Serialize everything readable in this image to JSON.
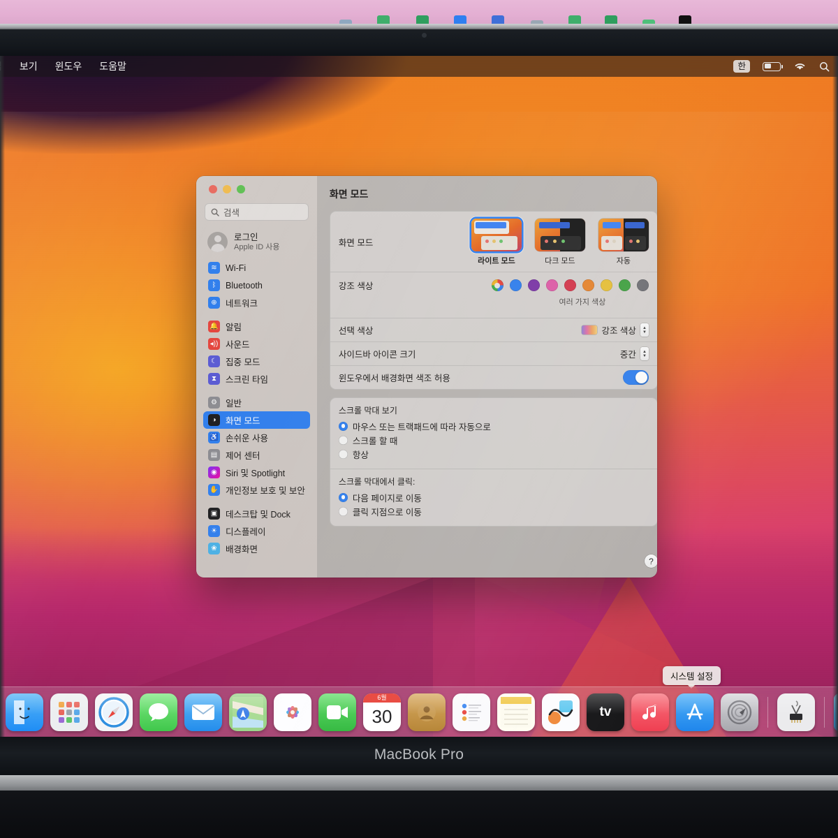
{
  "device": {
    "brand": "MacBook Pro"
  },
  "menubar": {
    "items": [
      "집",
      "보기",
      "윈도우",
      "도움말"
    ],
    "status": {
      "ime": "한",
      "battery_icon": "battery-icon",
      "wifi_icon": "wifi-icon",
      "search_icon": "search-icon"
    }
  },
  "window": {
    "title": "화면 모드",
    "traffic_lights": [
      "close",
      "minimize",
      "zoom"
    ],
    "search": {
      "placeholder": "검색",
      "icon": "search-icon"
    },
    "account": {
      "name": "로그인",
      "subtitle": "Apple ID 사용",
      "avatar": "avatar-placeholder"
    },
    "sidebar_groups": [
      [
        {
          "label": "Wi-Fi",
          "icon": "wifi-icon",
          "color": "#2f7ff0"
        },
        {
          "label": "Bluetooth",
          "icon": "bluetooth-icon",
          "color": "#2f7ff0"
        },
        {
          "label": "네트워크",
          "icon": "globe-icon",
          "color": "#2f7ff0"
        }
      ],
      [
        {
          "label": "알림",
          "icon": "bell-icon",
          "color": "#e8453c"
        },
        {
          "label": "사운드",
          "icon": "speaker-icon",
          "color": "#e8453c"
        },
        {
          "label": "집중 모드",
          "icon": "moon-icon",
          "color": "#5b5bd6"
        },
        {
          "label": "스크린 타임",
          "icon": "hourglass-icon",
          "color": "#5b5bd6"
        }
      ],
      [
        {
          "label": "일반",
          "icon": "gear-icon",
          "color": "#8e8e93"
        },
        {
          "label": "화면 모드",
          "icon": "appearance-icon",
          "color": "#1c1c1e",
          "selected": true
        },
        {
          "label": "손쉬운 사용",
          "icon": "accessibility-icon",
          "color": "#2f7ff0"
        },
        {
          "label": "제어 센터",
          "icon": "control-center-icon",
          "color": "#8e8e93"
        },
        {
          "label": "Siri 및 Spotlight",
          "icon": "siri-icon",
          "color": "#1c1c3e"
        },
        {
          "label": "개인정보 보호 및 보안",
          "icon": "hand-icon",
          "color": "#2f7ff0"
        }
      ],
      [
        {
          "label": "데스크탑 및 Dock",
          "icon": "desktop-dock-icon",
          "color": "#1c1c1e"
        },
        {
          "label": "디스플레이",
          "icon": "brightness-icon",
          "color": "#2f7ff0"
        },
        {
          "label": "배경화면",
          "icon": "wallpaper-icon",
          "color": "#4ab3e8"
        }
      ]
    ],
    "appearance": {
      "row_label": "화면 모드",
      "modes": [
        {
          "label": "라이트 모드",
          "selected": true
        },
        {
          "label": "다크 모드",
          "selected": false
        },
        {
          "label": "자동",
          "selected": false
        }
      ]
    },
    "accent": {
      "row_label": "강조 색상",
      "note": "여러 가지 색상",
      "swatches": [
        {
          "name": "multicolor",
          "color": "multi",
          "selected": true
        },
        {
          "name": "blue",
          "color": "#2f7ff0"
        },
        {
          "name": "purple",
          "color": "#7b34a8"
        },
        {
          "name": "pink",
          "color": "#e05aa8"
        },
        {
          "name": "red",
          "color": "#d6354a"
        },
        {
          "name": "orange",
          "color": "#e8842c"
        },
        {
          "name": "yellow",
          "color": "#e8c136"
        },
        {
          "name": "green",
          "color": "#3fa23f"
        },
        {
          "name": "graphite",
          "color": "#6e6e73"
        }
      ]
    },
    "rows": [
      {
        "label": "선택 색상",
        "value": "강조 색상",
        "control": "popup-with-gradient-chip"
      },
      {
        "label": "사이드바 아이콘 크기",
        "value": "중간",
        "control": "popup"
      },
      {
        "label": "윈도우에서 배경화면 색조 허용",
        "value": "on",
        "control": "toggle"
      }
    ],
    "scrollbar_show": {
      "title": "스크롤 막대 보기",
      "options": [
        {
          "label": "마우스 또는 트랙패드에 따라 자동으로",
          "selected": true
        },
        {
          "label": "스크롤 할 때",
          "selected": false
        },
        {
          "label": "항상",
          "selected": false
        }
      ]
    },
    "scrollbar_click": {
      "title": "스크롤 막대에서 클릭:",
      "options": [
        {
          "label": "다음 페이지로 이동",
          "selected": true
        },
        {
          "label": "클릭 지점으로 이동",
          "selected": false
        }
      ]
    },
    "help_button": "?"
  },
  "dock": {
    "tooltip": "시스템 설정",
    "calendar": {
      "month": "6월",
      "day": "30"
    },
    "items": [
      {
        "name": "finder",
        "label": "Finder",
        "color": "#1f8df5",
        "glyph": ""
      },
      {
        "name": "launchpad",
        "label": "Launchpad",
        "color": "#e9e9ec",
        "glyph": ""
      },
      {
        "name": "safari",
        "label": "Safari",
        "color": "#f2f2f4",
        "glyph": ""
      },
      {
        "name": "messages",
        "label": "메시지",
        "color": "#4fd45a",
        "glyph": ""
      },
      {
        "name": "mail",
        "label": "Mail",
        "color": "#2f9bf0",
        "glyph": ""
      },
      {
        "name": "maps",
        "label": "지도",
        "color": "#8fd17a",
        "glyph": ""
      },
      {
        "name": "photos",
        "label": "사진",
        "color": "#fbfbfd",
        "glyph": ""
      },
      {
        "name": "facetime",
        "label": "FaceTime",
        "color": "#3fc94b",
        "glyph": ""
      },
      {
        "name": "calendar",
        "label": "캘린더",
        "color": "#ffffff",
        "glyph": ""
      },
      {
        "name": "contacts",
        "label": "연락처",
        "color": "#c08a3e",
        "glyph": ""
      },
      {
        "name": "reminders",
        "label": "미리 알림",
        "color": "#f7f7f8",
        "glyph": ""
      },
      {
        "name": "notes",
        "label": "메모",
        "color": "#fbf6e4",
        "glyph": ""
      },
      {
        "name": "freeform",
        "label": "Freeform",
        "color": "#fafafa",
        "glyph": ""
      },
      {
        "name": "appletv",
        "label": "Apple TV",
        "color": "#1b1b1d",
        "glyph": "tv"
      },
      {
        "name": "music",
        "label": "음악",
        "color": "#f4525f",
        "glyph": "♪"
      },
      {
        "name": "appstore",
        "label": "App Store",
        "color": "#2f9bf0",
        "glyph": "A"
      },
      {
        "name": "system-settings",
        "label": "시스템 설정",
        "color": "#b9b9bd",
        "glyph": "",
        "running": true
      },
      {
        "name": "utility-app",
        "label": "유틸리티",
        "color": "#e4e4e6",
        "glyph": ""
      },
      {
        "name": "downloads-folder",
        "label": "다운로드",
        "color": "#4aa8e0",
        "glyph": "↓"
      }
    ]
  }
}
